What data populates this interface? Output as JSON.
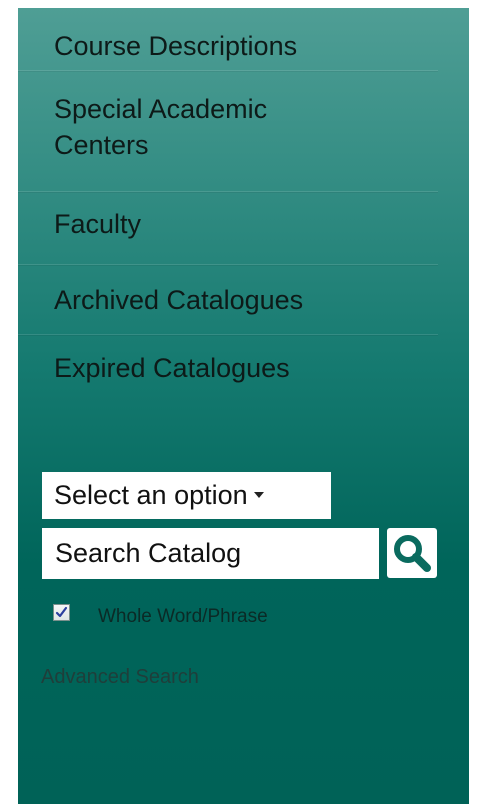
{
  "nav": {
    "items": [
      {
        "label": "Course Descriptions"
      },
      {
        "label": "Special Academic Centers"
      },
      {
        "label": "Faculty"
      },
      {
        "label": "Archived Catalogues"
      },
      {
        "label": "Expired Catalogues"
      }
    ]
  },
  "search": {
    "select_value": "Select an option",
    "placeholder": "Search Catalog",
    "whole_word_label": "Whole Word/Phrase",
    "whole_word_checked": true,
    "advanced_label": "Advanced Search"
  },
  "colors": {
    "panel_top": "#4f9e95",
    "panel_bottom": "#006257",
    "search_icon": "#0a6b5f"
  }
}
